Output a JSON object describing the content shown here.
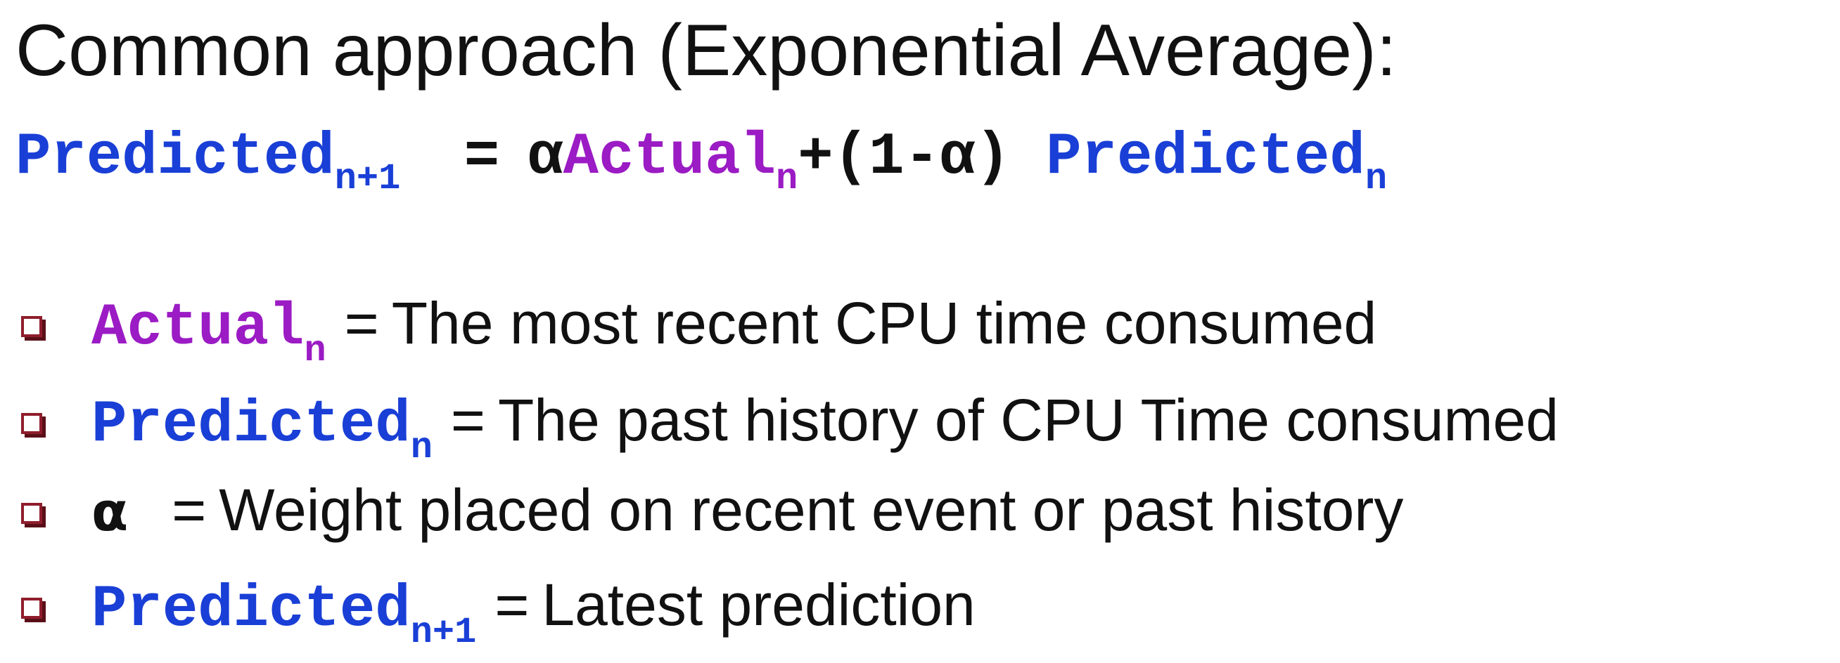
{
  "heading": "Common approach (Exponential Average):",
  "formula": {
    "lhs": "Predicted",
    "lhs_sub": "n+1",
    "equals": "=",
    "alpha": "α",
    "actual": "Actual",
    "actual_sub": "n",
    "middle": "+(1-α)",
    "predicted": "Predicted",
    "predicted_sub": "n"
  },
  "bullets": [
    {
      "term": "Actual",
      "term_sub": "n",
      "equals": "=",
      "description": "The most recent CPU time consumed"
    },
    {
      "term": "Predicted",
      "term_sub": "n",
      "equals": "=",
      "description": "The past history of CPU Time consumed"
    },
    {
      "term": "α",
      "term_sub": "",
      "equals": "=",
      "description": "Weight placed on recent event or past history"
    },
    {
      "term": "Predicted",
      "term_sub": "n+1",
      "equals": "=",
      "description": "Latest prediction"
    }
  ],
  "colors": {
    "predicted": "#1a3fd6",
    "actual": "#9b1bc4",
    "text": "#111111",
    "bullet_marker": "#8f1d2c"
  },
  "icons": {
    "bullet_marker": "hollow-square-bullet-icon"
  }
}
